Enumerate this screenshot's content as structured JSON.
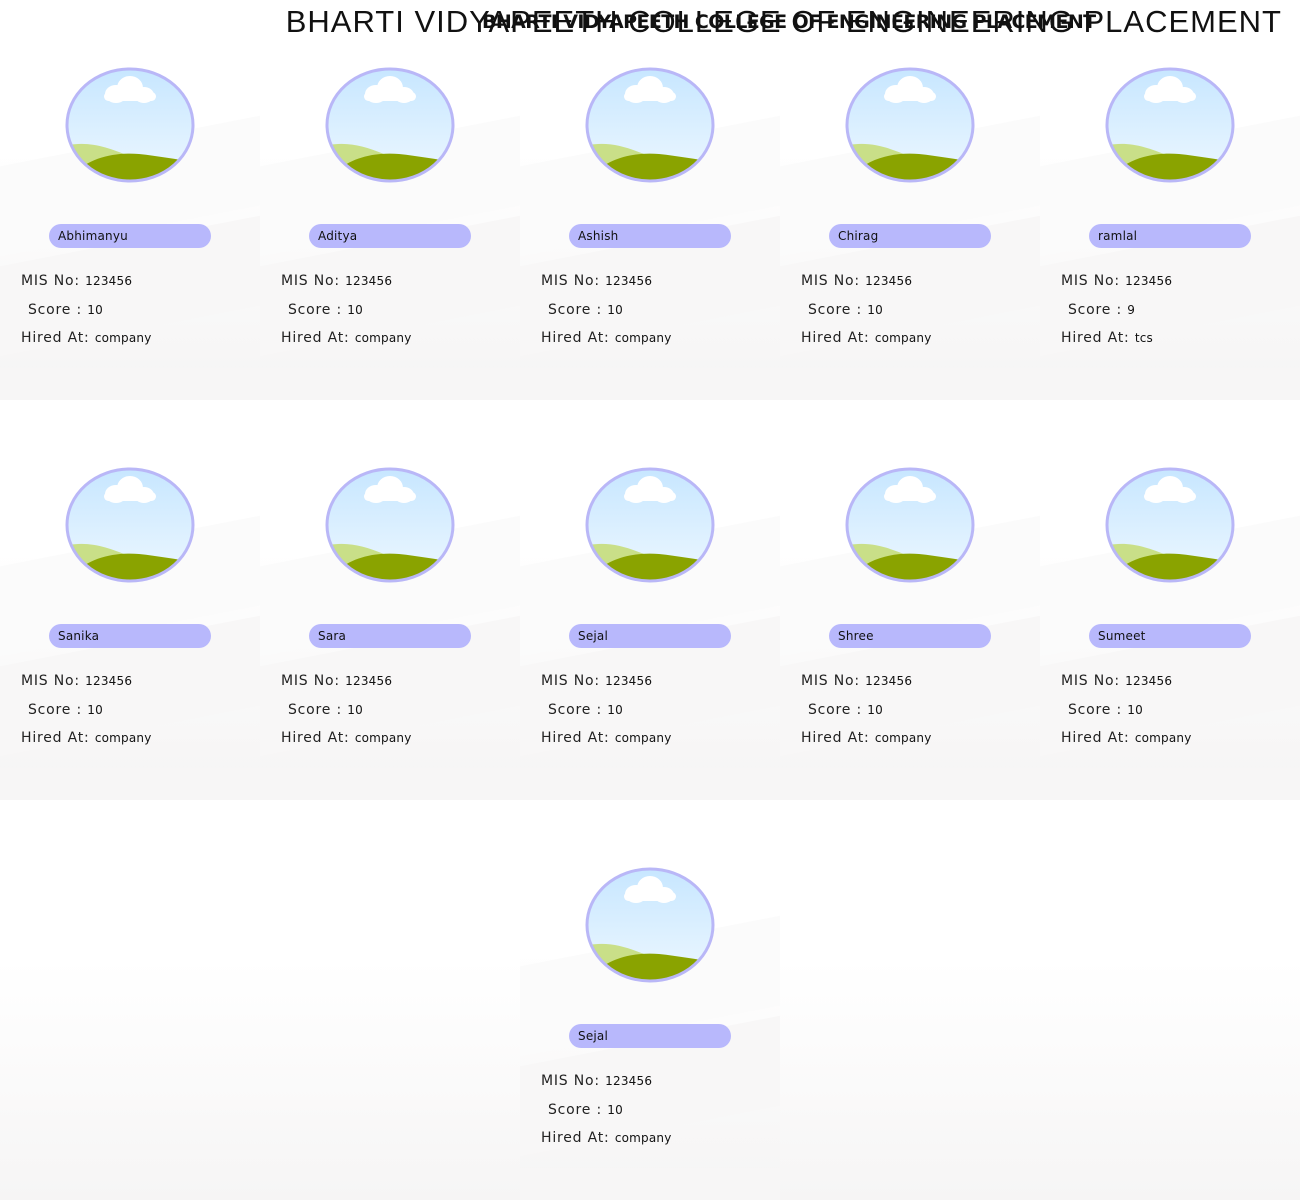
{
  "header": {
    "title": "BHARTI  VIDYAPEETH  COLLEGE  OF  ENGINEERING  PLACEMENT",
    "title_overlay": "BHARTI VIDYAPEETH COLLEGE OF ENGINEERING PLACEMENT"
  },
  "labels": {
    "mis": "MIS No: ",
    "score": "Score : ",
    "hired": "Hired At: "
  },
  "students": [
    {
      "name": "Abhimanyu",
      "mis": "123456",
      "score": "10",
      "hired": "company"
    },
    {
      "name": "Aditya",
      "mis": "123456",
      "score": "10",
      "hired": "company"
    },
    {
      "name": "Ashish",
      "mis": "123456",
      "score": "10",
      "hired": "company"
    },
    {
      "name": "Chirag",
      "mis": "123456",
      "score": "10",
      "hired": "company"
    },
    {
      "name": "ramlal",
      "mis": "123456",
      "score": "9",
      "hired": "tcs"
    },
    {
      "name": "Sanika",
      "mis": "123456",
      "score": "10",
      "hired": "company"
    },
    {
      "name": "Sara",
      "mis": "123456",
      "score": "10",
      "hired": "company"
    },
    {
      "name": "Sejal",
      "mis": "123456",
      "score": "10",
      "hired": "company"
    },
    {
      "name": "Shree",
      "mis": "123456",
      "score": "10",
      "hired": "company"
    },
    {
      "name": "Sumeet",
      "mis": "123456",
      "score": "10",
      "hired": "company"
    },
    {
      "name": "Sejal",
      "mis": "123456",
      "score": "10",
      "hired": "company"
    }
  ],
  "colors": {
    "pill": "#b8b8fc",
    "avatar_ring": "#b9b7f7",
    "sky_top": "#c6e6ff",
    "sky_bottom": "#eef8ff",
    "hill_light": "#c9df88",
    "hill_dark": "#8aa300"
  },
  "icons": {
    "avatar": "landscape-avatar-icon"
  }
}
